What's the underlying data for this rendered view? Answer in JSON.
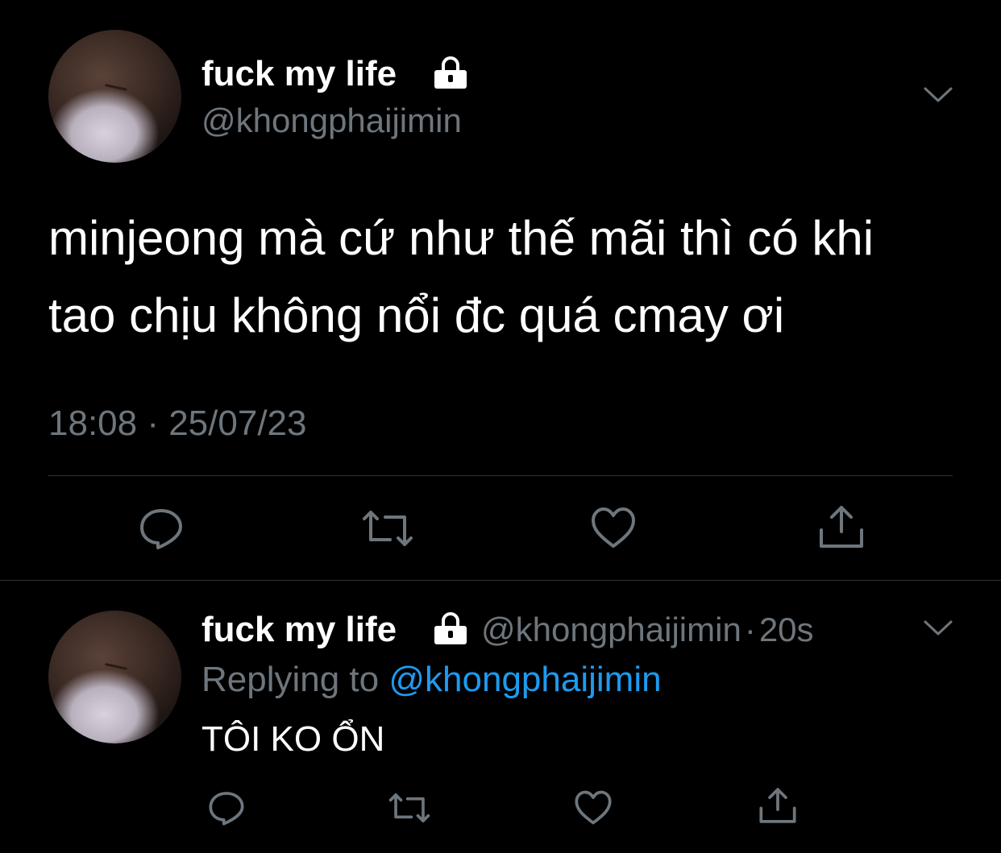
{
  "main_tweet": {
    "display_name": "fuck my life",
    "handle": "@khongphaijimin",
    "text_line1": "minjeong mà cứ như thế mãi thì có khi",
    "text_line2": "tao chịu không nổi đc quá cmay ơi",
    "timestamp": "18:08 · 25/07/23",
    "icons": [
      "lock-icon",
      "chevron-down-icon",
      "reply-icon",
      "retweet-icon",
      "like-icon",
      "share-icon"
    ]
  },
  "reply_tweet": {
    "display_name": "fuck my life",
    "handle": "@khongphaijimin",
    "separator": "·",
    "time": "20s",
    "replying_prefix": "Replying to",
    "replying_handle": "@khongphaijimin",
    "text": "TÔI KO ỔN",
    "icons": [
      "lock-icon",
      "chevron-down-icon",
      "reply-icon",
      "retweet-icon",
      "like-icon",
      "share-icon"
    ]
  },
  "colors": {
    "background": "#000000",
    "text": "#ffffff",
    "muted": "#6e767d",
    "link": "#1d9bf0",
    "divider": "#2f3336"
  }
}
